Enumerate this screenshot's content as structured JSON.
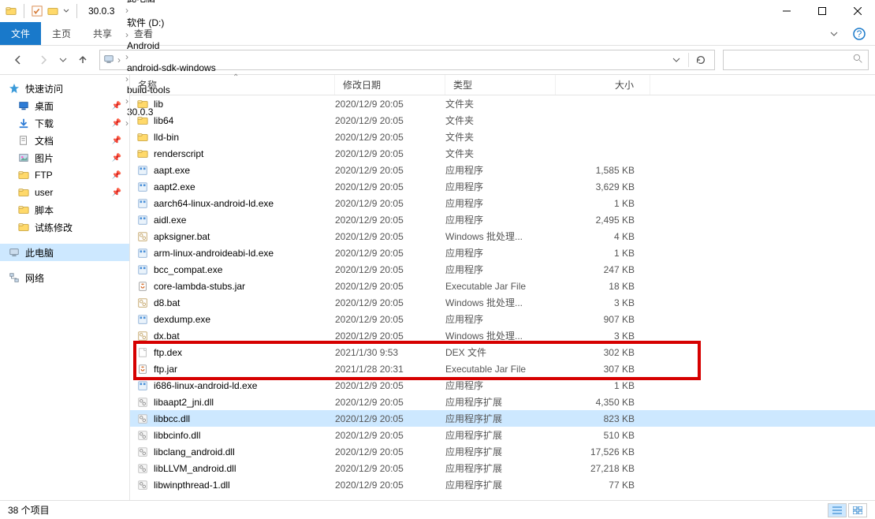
{
  "title": "30.0.3",
  "ribbon": {
    "file": "文件",
    "home": "主页",
    "share": "共享",
    "view": "查看"
  },
  "breadcrumbs": [
    "此电脑",
    "软件 (D:)",
    "Android",
    "android-sdk-windows",
    "build-tools",
    "30.0.3"
  ],
  "columns": {
    "name": "名称",
    "date": "修改日期",
    "type": "类型",
    "size": "大小"
  },
  "nav": {
    "quick": {
      "label": "快速访问",
      "items": [
        {
          "icon": "desktop",
          "label": "桌面",
          "pinned": true
        },
        {
          "icon": "downloads",
          "label": "下载",
          "pinned": true
        },
        {
          "icon": "documents",
          "label": "文档",
          "pinned": true
        },
        {
          "icon": "pictures",
          "label": "图片",
          "pinned": true
        },
        {
          "icon": "folder",
          "label": "FTP",
          "pinned": true
        },
        {
          "icon": "folder",
          "label": "user",
          "pinned": true
        },
        {
          "icon": "folder",
          "label": "脚本",
          "pinned": false
        },
        {
          "icon": "folder",
          "label": "试练修改",
          "pinned": false
        }
      ]
    },
    "pc": {
      "label": "此电脑"
    },
    "network": {
      "label": "网络"
    }
  },
  "rows": [
    {
      "icon": "folder",
      "name": "lib",
      "date": "2020/12/9 20:05",
      "type": "文件夹",
      "size": ""
    },
    {
      "icon": "folder",
      "name": "lib64",
      "date": "2020/12/9 20:05",
      "type": "文件夹",
      "size": ""
    },
    {
      "icon": "folder",
      "name": "lld-bin",
      "date": "2020/12/9 20:05",
      "type": "文件夹",
      "size": ""
    },
    {
      "icon": "folder",
      "name": "renderscript",
      "date": "2020/12/9 20:05",
      "type": "文件夹",
      "size": ""
    },
    {
      "icon": "exe",
      "name": "aapt.exe",
      "date": "2020/12/9 20:05",
      "type": "应用程序",
      "size": "1,585 KB"
    },
    {
      "icon": "exe",
      "name": "aapt2.exe",
      "date": "2020/12/9 20:05",
      "type": "应用程序",
      "size": "3,629 KB"
    },
    {
      "icon": "exe",
      "name": "aarch64-linux-android-ld.exe",
      "date": "2020/12/9 20:05",
      "type": "应用程序",
      "size": "1 KB"
    },
    {
      "icon": "exe",
      "name": "aidl.exe",
      "date": "2020/12/9 20:05",
      "type": "应用程序",
      "size": "2,495 KB"
    },
    {
      "icon": "bat",
      "name": "apksigner.bat",
      "date": "2020/12/9 20:05",
      "type": "Windows 批处理...",
      "size": "4 KB"
    },
    {
      "icon": "exe",
      "name": "arm-linux-androideabi-ld.exe",
      "date": "2020/12/9 20:05",
      "type": "应用程序",
      "size": "1 KB"
    },
    {
      "icon": "exe",
      "name": "bcc_compat.exe",
      "date": "2020/12/9 20:05",
      "type": "应用程序",
      "size": "247 KB"
    },
    {
      "icon": "jar",
      "name": "core-lambda-stubs.jar",
      "date": "2020/12/9 20:05",
      "type": "Executable Jar File",
      "size": "18 KB"
    },
    {
      "icon": "bat",
      "name": "d8.bat",
      "date": "2020/12/9 20:05",
      "type": "Windows 批处理...",
      "size": "3 KB"
    },
    {
      "icon": "exe",
      "name": "dexdump.exe",
      "date": "2020/12/9 20:05",
      "type": "应用程序",
      "size": "907 KB"
    },
    {
      "icon": "bat",
      "name": "dx.bat",
      "date": "2020/12/9 20:05",
      "type": "Windows 批处理...",
      "size": "3 KB"
    },
    {
      "icon": "file",
      "name": "ftp.dex",
      "date": "2021/1/30 9:53",
      "type": "DEX 文件",
      "size": "302 KB"
    },
    {
      "icon": "jar",
      "name": "ftp.jar",
      "date": "2021/1/28 20:31",
      "type": "Executable Jar File",
      "size": "307 KB"
    },
    {
      "icon": "exe",
      "name": "i686-linux-android-ld.exe",
      "date": "2020/12/9 20:05",
      "type": "应用程序",
      "size": "1 KB"
    },
    {
      "icon": "dll",
      "name": "libaapt2_jni.dll",
      "date": "2020/12/9 20:05",
      "type": "应用程序扩展",
      "size": "4,350 KB"
    },
    {
      "icon": "dll",
      "name": "libbcc.dll",
      "date": "2020/12/9 20:05",
      "type": "应用程序扩展",
      "size": "823 KB",
      "selected": true
    },
    {
      "icon": "dll",
      "name": "libbcinfo.dll",
      "date": "2020/12/9 20:05",
      "type": "应用程序扩展",
      "size": "510 KB"
    },
    {
      "icon": "dll",
      "name": "libclang_android.dll",
      "date": "2020/12/9 20:05",
      "type": "应用程序扩展",
      "size": "17,526 KB"
    },
    {
      "icon": "dll",
      "name": "libLLVM_android.dll",
      "date": "2020/12/9 20:05",
      "type": "应用程序扩展",
      "size": "27,218 KB"
    },
    {
      "icon": "dll",
      "name": "libwinpthread-1.dll",
      "date": "2020/12/9 20:05",
      "type": "应用程序扩展",
      "size": "77 KB"
    }
  ],
  "highlight": {
    "startRow": 15,
    "endRow": 16
  },
  "status": {
    "count": "38 个项目"
  }
}
